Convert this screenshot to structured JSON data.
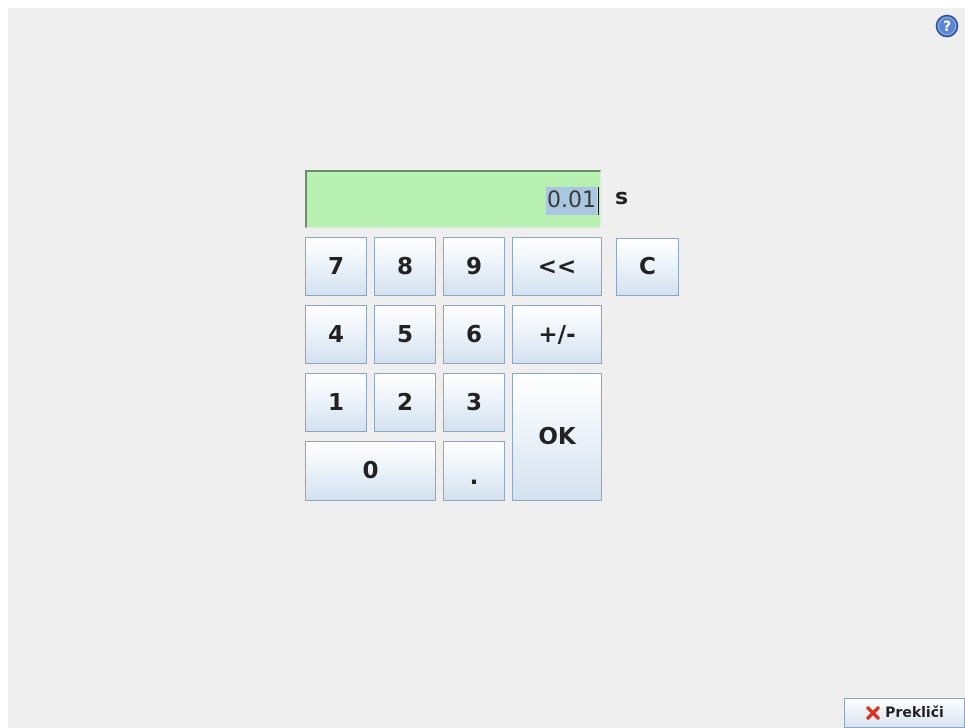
{
  "display": {
    "value": "0.01",
    "unit": "s"
  },
  "keys": {
    "k7": "7",
    "k8": "8",
    "k9": "9",
    "backspace": "<<",
    "clear": "C",
    "k4": "4",
    "k5": "5",
    "k6": "6",
    "sign": "+/-",
    "k1": "1",
    "k2": "2",
    "k3": "3",
    "ok": "OK",
    "k0": "0",
    "dot": "."
  },
  "footer": {
    "cancel_label": "Prekliči"
  },
  "icons": {
    "help": "help-icon",
    "cancel": "close-x-icon"
  },
  "colors": {
    "display_bg": "#b8f0b2",
    "selection": "#a9c7df",
    "cancel_x": "#d9341f"
  }
}
